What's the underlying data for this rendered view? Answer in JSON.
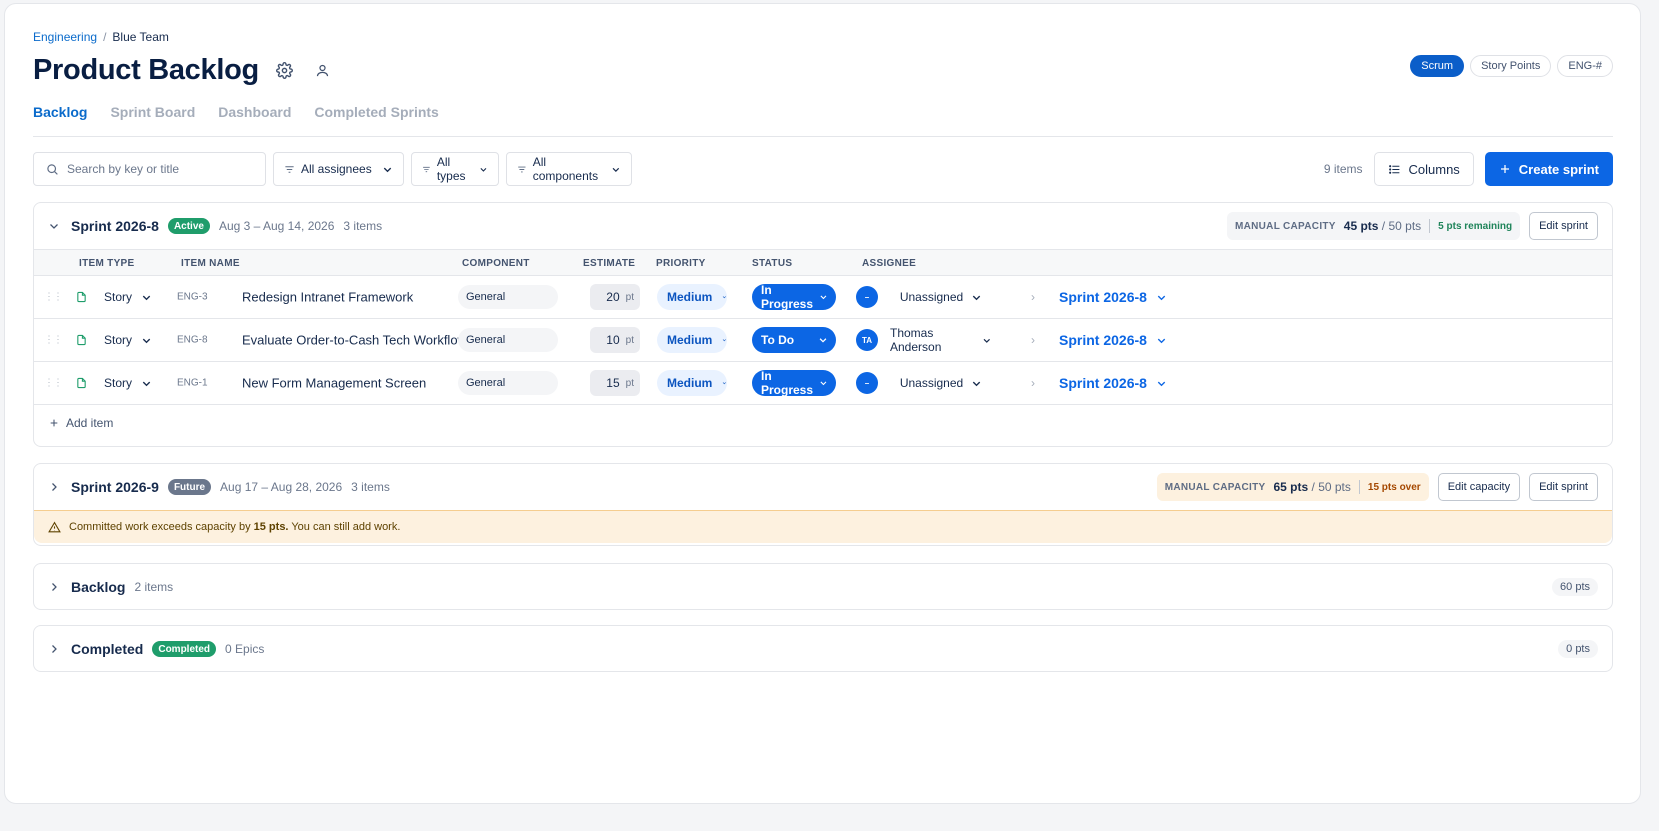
{
  "breadcrumb": {
    "parent": "Engineering",
    "separator": "/",
    "current": "Blue Team"
  },
  "page_title": "Product Backlog",
  "top_pills": [
    "Scrum",
    "Story Points",
    "ENG-#"
  ],
  "tabs": [
    "Backlog",
    "Sprint Board",
    "Dashboard",
    "Completed Sprints"
  ],
  "toolbar": {
    "search_placeholder": "Search by key or title",
    "filter_assignees": "All assignees",
    "filter_types": "All types",
    "filter_components": "All components",
    "item_count": "9 items",
    "columns_label": "Columns",
    "create_sprint_label": "Create sprint"
  },
  "sprint1": {
    "name": "Sprint 2026-8",
    "badge": "Active",
    "dates": "Aug 3 – Aug 14, 2026",
    "count": "3 items",
    "capacity_label": "MANUAL CAPACITY",
    "capacity_used": "45 pts",
    "capacity_total": " / 50 pts",
    "capacity_note": "5 pts remaining",
    "edit_sprint": "Edit sprint",
    "columns": [
      "ITEM TYPE",
      "ITEM NAME",
      "COMPONENT",
      "ESTIMATE",
      "PRIORITY",
      "STATUS",
      "ASSIGNEE"
    ],
    "rows": [
      {
        "type": "Story",
        "key": "ENG-3",
        "name": "Redesign Intranet Framework",
        "component": "General",
        "estimate": "20",
        "unit": "pt",
        "priority": "Medium",
        "status": "In Progress",
        "avatar": "–",
        "assignee": "Unassigned",
        "sprint": "Sprint 2026-8"
      },
      {
        "type": "Story",
        "key": "ENG-8",
        "name": "Evaluate Order-to-Cash Tech Workflow",
        "component": "General",
        "estimate": "10",
        "unit": "pt",
        "priority": "Medium",
        "status": "To Do",
        "avatar": "TA",
        "assignee": "Thomas Anderson",
        "sprint": "Sprint 2026-8"
      },
      {
        "type": "Story",
        "key": "ENG-1",
        "name": "New Form Management Screen",
        "component": "General",
        "estimate": "15",
        "unit": "pt",
        "priority": "Medium",
        "status": "In Progress",
        "avatar": "–",
        "assignee": "Unassigned",
        "sprint": "Sprint 2026-8"
      }
    ],
    "add_item": "Add item"
  },
  "sprint2": {
    "name": "Sprint 2026-9",
    "badge": "Future",
    "dates": "Aug 17 – Aug 28, 2026",
    "count": "3 items",
    "capacity_label": "MANUAL CAPACITY",
    "capacity_used": "65 pts",
    "capacity_total": " / 50 pts",
    "capacity_note": "15 pts over",
    "edit_capacity": "Edit capacity",
    "edit_sprint": "Edit sprint",
    "warning_pre": "Committed work exceeds capacity by ",
    "warning_bold": "15 pts.",
    "warning_post": " You can still add work."
  },
  "backlog": {
    "name": "Backlog",
    "count": "2 items",
    "points": "60 pts"
  },
  "completed": {
    "name": "Completed",
    "badge": "Completed",
    "count": "0 Epics",
    "points": "0 pts"
  },
  "colors": {
    "accent": "#0c66e4",
    "active_badge": "#1f9d6b",
    "future_badge": "#6b778c",
    "warning_bg": "#fdf1df"
  },
  "icons": [
    "settings-gear-icon",
    "person-icon",
    "search-icon",
    "filter-icon",
    "chevron-down-icon",
    "columns-list-icon",
    "plus-icon",
    "document-icon",
    "drag-handle-icon",
    "chevron-right-icon",
    "warning-triangle-icon"
  ]
}
